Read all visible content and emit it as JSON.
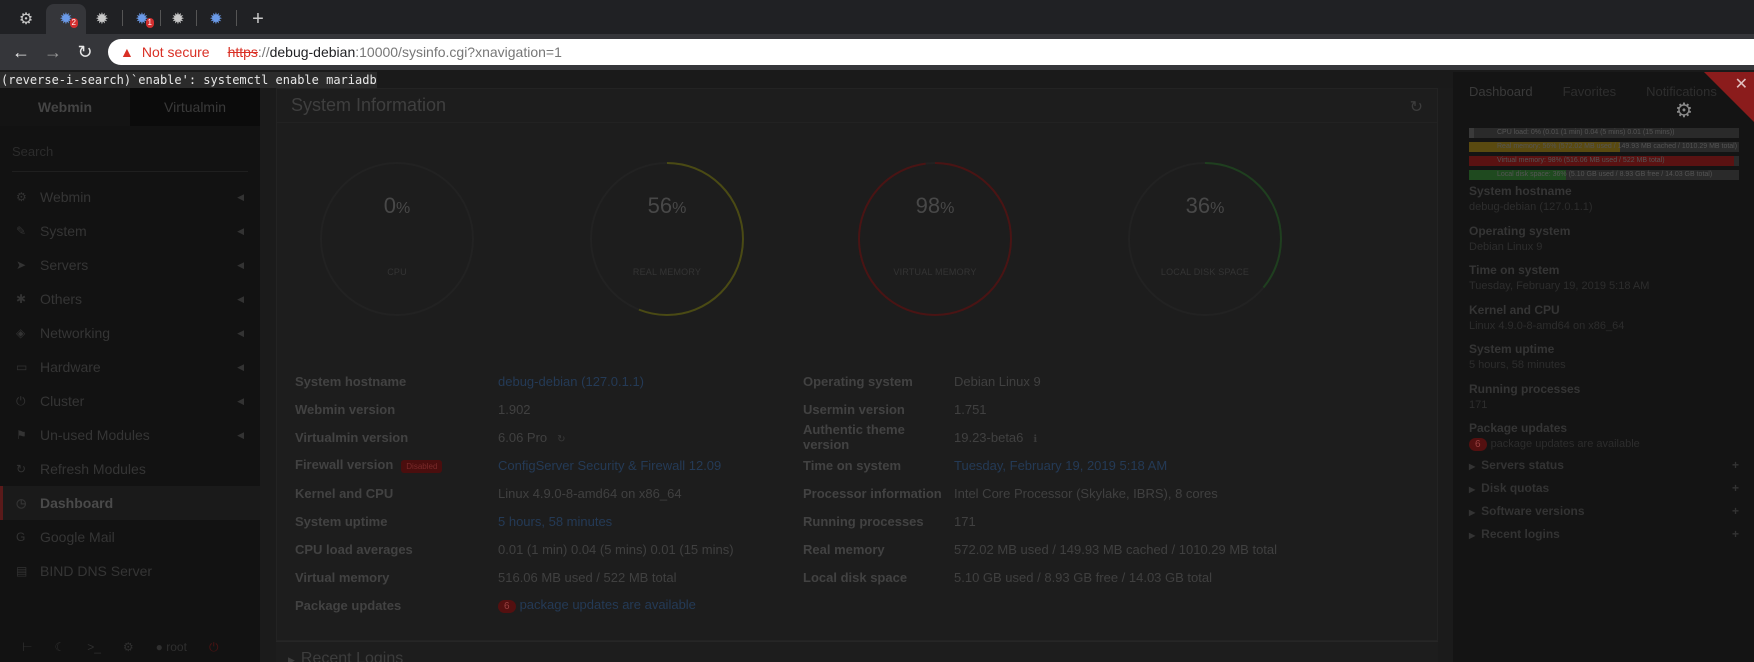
{
  "browser": {
    "tabs": [
      {
        "icon": "tool-icon",
        "glyph": "⚙",
        "badge": ""
      },
      {
        "icon": "webmin-icon",
        "glyph": "✹",
        "badge": "2"
      },
      {
        "icon": "webmin-icon",
        "glyph": "✹",
        "badge": ""
      },
      {
        "icon": "webmin-icon",
        "glyph": "✹",
        "badge": "1"
      },
      {
        "icon": "webmin-icon",
        "glyph": "✹",
        "badge": ""
      },
      {
        "icon": "webmin-icon",
        "glyph": "✹",
        "badge": ""
      }
    ],
    "new_tab": "+",
    "back": "←",
    "forward": "→",
    "reload": "↻",
    "not_secure": "Not secure",
    "url_proto": "https",
    "url_sep": "://",
    "url_host": "debug-debian",
    "url_rest": ":10000/sysinfo.cgi?xnavigation=1"
  },
  "terminal": {
    "line": "(reverse-i-search)`enable': systemctl enable mariadb"
  },
  "sidebar": {
    "tab_webmin": "Webmin",
    "tab_virtualmin": "Virtualmin",
    "search_placeholder": "Search",
    "items": [
      {
        "label": "Webmin",
        "icon": "⚙",
        "caret": "◀"
      },
      {
        "label": "System",
        "icon": "✎",
        "caret": "◀"
      },
      {
        "label": "Servers",
        "icon": "➤",
        "caret": "◀"
      },
      {
        "label": "Others",
        "icon": "✱",
        "caret": "◀"
      },
      {
        "label": "Networking",
        "icon": "◈",
        "caret": "◀"
      },
      {
        "label": "Hardware",
        "icon": "▭",
        "caret": "◀"
      },
      {
        "label": "Cluster",
        "icon": "⏻",
        "caret": "◀"
      },
      {
        "label": "Un-used Modules",
        "icon": "⚑",
        "caret": "◀"
      },
      {
        "label": "Refresh Modules",
        "icon": "↻",
        "caret": ""
      },
      {
        "label": "Dashboard",
        "icon": "◷",
        "caret": ""
      },
      {
        "label": "Google Mail",
        "icon": "G",
        "caret": ""
      },
      {
        "label": "BIND DNS Server",
        "icon": "▤",
        "caret": ""
      }
    ],
    "bottom": {
      "term": "⊢",
      "night": "☾",
      "shell": ">_",
      "config": "⚙",
      "user": "root",
      "logout": "⏻"
    }
  },
  "main": {
    "title": "System Information",
    "refresh": "↻",
    "gauges": [
      {
        "value": "0",
        "unit": "%",
        "label": "CPU",
        "pct": 0,
        "color": "#3a3a3a"
      },
      {
        "value": "56",
        "unit": "%",
        "label": "REAL MEMORY",
        "pct": 56,
        "color": "#4a4a14"
      },
      {
        "value": "98",
        "unit": "%",
        "label": "VIRTUAL MEMORY",
        "pct": 98,
        "color": "#4a1414"
      },
      {
        "value": "36",
        "unit": "%",
        "label": "LOCAL DISK SPACE",
        "pct": 36,
        "color": "#1f3f1f"
      }
    ],
    "left_rows": [
      {
        "k": "System hostname",
        "v": "debug-debian (127.0.1.1)",
        "link": true
      },
      {
        "k": "Webmin version",
        "v": "1.902",
        "link": false
      },
      {
        "k": "Virtualmin version",
        "v": "6.06 Pro",
        "link": false,
        "extra": "↻"
      },
      {
        "k": "Firewall version",
        "badge": "Disabled",
        "v": "ConfigServer Security & Firewall 12.09",
        "link": true
      },
      {
        "k": "Kernel and CPU",
        "v": "Linux 4.9.0-8-amd64 on x86_64",
        "link": false
      },
      {
        "k": "System uptime",
        "v": "5 hours, 58 minutes",
        "link": true
      },
      {
        "k": "CPU load averages",
        "v": "0.01 (1 min) 0.04 (5 mins) 0.01 (15 mins)",
        "link": false
      },
      {
        "k": "Virtual memory",
        "v": "516.06 MB used / 522 MB total",
        "link": false
      },
      {
        "k": "Package updates",
        "count": "6",
        "v": "package updates are available",
        "link": true
      }
    ],
    "right_rows": [
      {
        "k": "Operating system",
        "v": "Debian Linux 9",
        "link": false
      },
      {
        "k": "Usermin version",
        "v": "1.751",
        "link": false
      },
      {
        "k": "Authentic theme version",
        "v": "19.23-beta6",
        "link": false,
        "extra": "ℹ"
      },
      {
        "k": "Time on system",
        "v": "Tuesday, February 19, 2019 5:18 AM",
        "link": true
      },
      {
        "k": "Processor information",
        "v": "Intel Core Processor (Skylake, IBRS), 8 cores",
        "link": false
      },
      {
        "k": "Running processes",
        "v": "171",
        "link": false
      },
      {
        "k": "Real memory",
        "v": "572.02 MB used / 149.93 MB cached / 1010.29 MB total",
        "link": false
      },
      {
        "k": "Local disk space",
        "v": "5.10 GB used / 8.93 GB free / 14.03 GB total",
        "link": false
      }
    ],
    "recent_logins": "Recent Logins"
  },
  "right_panel": {
    "tabs": [
      "Dashboard",
      "Favorites",
      "Notifications"
    ],
    "gear": "⚙",
    "close": "✕",
    "bars": [
      {
        "text": "CPU load: 0% (0.01 (1 min) 0.04 (5 mins) 0.01 (15 mins))",
        "pct": 2,
        "color": "#3a3a3a"
      },
      {
        "text": "Real memory: 56% (572.02 MB used / 149.93 MB cached / 1010.29 MB total)",
        "pct": 56,
        "color": "#5a4a10"
      },
      {
        "text": "Virtual memory: 98% (516.06 MB used / 522 MB total)",
        "pct": 98,
        "color": "#5a1212"
      },
      {
        "text": "Local disk space: 36% (5.10 GB used / 8.93 GB free / 14.03 GB total)",
        "pct": 36,
        "color": "#1f4a1f"
      }
    ],
    "items": [
      {
        "k": "System hostname",
        "v": "debug-debian (127.0.1.1)"
      },
      {
        "k": "Operating system",
        "v": "Debian Linux 9"
      },
      {
        "k": "Time on system",
        "v": "Tuesday, February 19, 2019 5:18 AM"
      },
      {
        "k": "Kernel and CPU",
        "v": "Linux 4.9.0-8-amd64 on x86_64"
      },
      {
        "k": "System uptime",
        "v": "5 hours, 58 minutes"
      },
      {
        "k": "Running processes",
        "v": "171"
      },
      {
        "k": "Package updates",
        "v": "package updates are available",
        "count": "6"
      }
    ],
    "accordions": [
      "Servers status",
      "Disk quotas",
      "Software versions",
      "Recent logins"
    ],
    "plus": "+",
    "tri": "▶"
  }
}
